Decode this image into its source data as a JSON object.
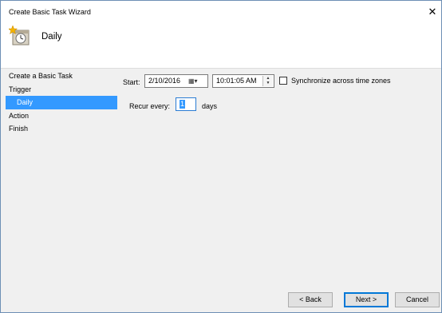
{
  "window": {
    "title": "Create Basic Task Wizard"
  },
  "header": {
    "title": "Daily",
    "icon": "task-clock-icon"
  },
  "steps": [
    {
      "label": "Create a Basic Task",
      "active": false,
      "sub": false
    },
    {
      "label": "Trigger",
      "active": false,
      "sub": false
    },
    {
      "label": "Daily",
      "active": true,
      "sub": true
    },
    {
      "label": "Action",
      "active": false,
      "sub": false
    },
    {
      "label": "Finish",
      "active": false,
      "sub": false
    }
  ],
  "form": {
    "start_label": "Start:",
    "start_date": "2/10/2016",
    "start_time": "10:01:05 AM",
    "sync_label": "Synchronize across time zones",
    "recur_label": "Recur every:",
    "recur_value": "1",
    "recur_unit": "days"
  },
  "buttons": {
    "back": "< Back",
    "next": "Next >",
    "cancel": "Cancel"
  },
  "colors": {
    "selection": "#3399ff",
    "window_bg": "#f0f0f0"
  }
}
